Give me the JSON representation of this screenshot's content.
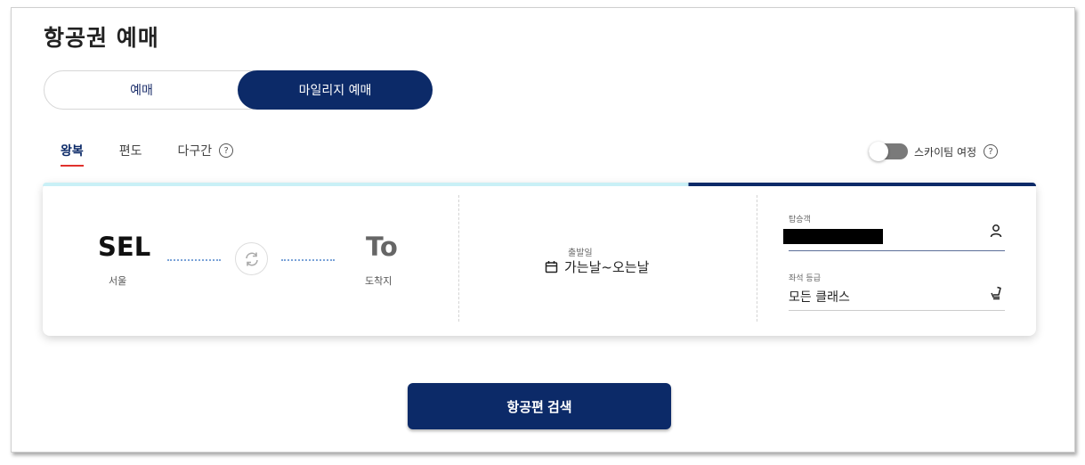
{
  "page": {
    "title": "항공권 예매"
  },
  "mode_toggle": {
    "normal_label": "예매",
    "mileage_label": "마일리지 예매"
  },
  "trip_tabs": [
    {
      "label": "왕복",
      "active": true
    },
    {
      "label": "편도",
      "active": false
    },
    {
      "label": "다구간",
      "active": false
    }
  ],
  "help_glyph": "?",
  "stopover": {
    "label": "스카이팀 여정",
    "enabled": false
  },
  "departure": {
    "code": "SEL",
    "name": "서울"
  },
  "arrival": {
    "code": "To",
    "name": "도착지"
  },
  "date": {
    "label": "출발일",
    "value": "가는날~오는날"
  },
  "passengers": {
    "label": "탑승객"
  },
  "cabin": {
    "label": "좌석 등급",
    "value": "모든 클래스"
  },
  "search": {
    "label": "항공편 검색"
  },
  "colors": {
    "primary": "#0c2a68",
    "tab_underline": "#e0322d",
    "progress_track": "#c9f0f6"
  },
  "icons": {
    "swap": "swap-arrows-icon",
    "calendar": "calendar-icon",
    "person": "person-icon",
    "seat": "seat-icon",
    "help": "help-circle-icon"
  }
}
